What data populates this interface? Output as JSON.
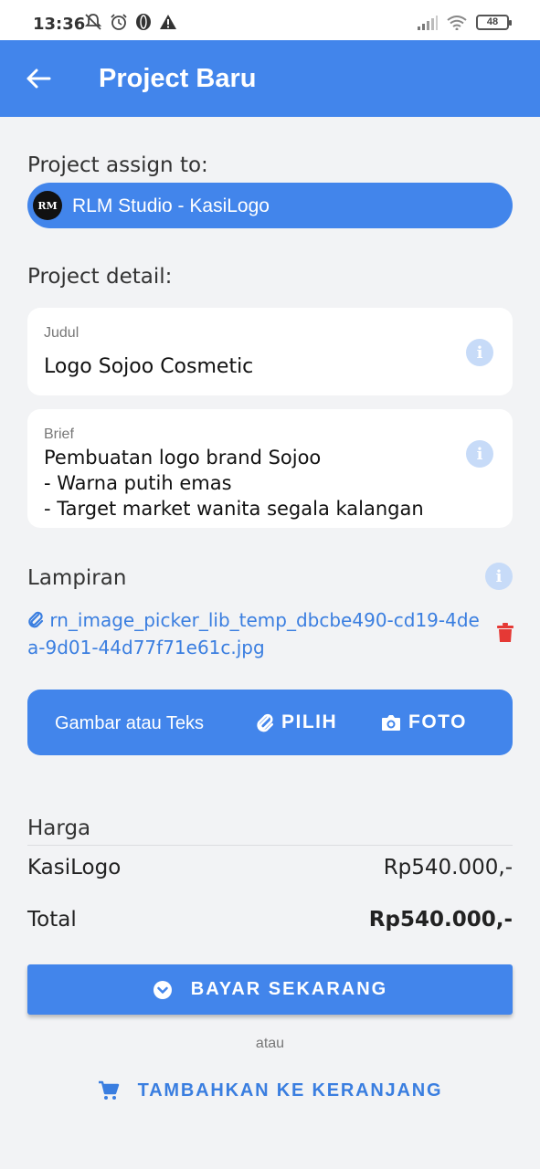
{
  "status_bar": {
    "time": "13:36",
    "battery": "48"
  },
  "app_bar": {
    "title": "Project Baru",
    "back_icon": "arrow-left-icon"
  },
  "assign": {
    "label": "Project assign to:",
    "avatar_text": "RM",
    "value": "RLM Studio - KasiLogo"
  },
  "detail": {
    "label": "Project detail:",
    "judul_label": "Judul",
    "judul_value": "Logo Sojoo Cosmetic",
    "brief_label": "Brief",
    "brief_lines": [
      "Pembuatan logo brand Sojoo",
      "- Warna putih emas",
      "- Target market wanita segala kalangan"
    ]
  },
  "lampiran": {
    "label": "Lampiran",
    "file_name": "rn_image_picker_lib_temp_dbcbe490-cd19-4dea-9d01-44d77f71e61c.jpg"
  },
  "picker": {
    "label": "Gambar atau Teks",
    "pilih_label": "PILIH",
    "foto_label": "FOTO"
  },
  "harga": {
    "label": "Harga",
    "item_name": "KasiLogo",
    "item_price": "Rp540.000,-",
    "total_label": "Total",
    "total_value": "Rp540.000,-"
  },
  "actions": {
    "pay_label": "BAYAR SEKARANG",
    "or_label": "atau",
    "cart_label": "TAMBAHKAN KE KERANJANG"
  },
  "colors": {
    "primary": "#4285eb",
    "link": "#3a7ee0",
    "danger": "#e53935",
    "background": "#f2f3f5"
  }
}
